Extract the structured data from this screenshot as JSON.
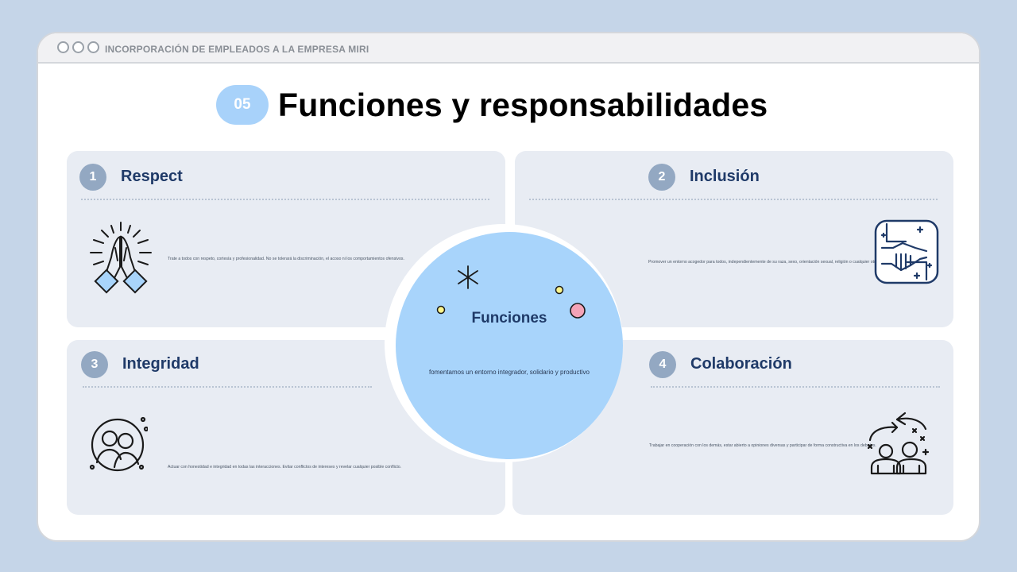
{
  "window": {
    "title": "INCORPORACIÓN DE EMPLEADOS A LA EMPRESA MIRI"
  },
  "header": {
    "number": "05",
    "title": "Funciones y responsabilidades"
  },
  "center": {
    "title": "Funciones",
    "description": "fomentamos un entorno integrador, solidario y productivo"
  },
  "cards": [
    {
      "number": "1",
      "title": "Respect",
      "description": "Trate a todos con respeto, cortesía y profesionalidad. No se tolerará la discriminación, el acoso ni los comportamientos ofensivos.",
      "icon": "praying-hands-icon"
    },
    {
      "number": "2",
      "title": "Inclusión",
      "description": "Promover un entorno acogedor para todos, independientemente de su raza, sexo, orientación sexual, religión o cualquier otra característica protegida.",
      "icon": "handshake-icon"
    },
    {
      "number": "3",
      "title": "Integridad",
      "description": "Actuar con honestidad e integridad en todas las interacciones. Evitar conflictos de intereses y revelar cualquier posible conflicto.",
      "icon": "people-circle-icon"
    },
    {
      "number": "4",
      "title": "Colaboración",
      "description": "Trabajar en cooperación con los demás, estar abierto a opiniones diversas y participar de forma constructiva en los debates.",
      "icon": "team-arrows-icon"
    }
  ],
  "colors": {
    "background": "#c5d5e8",
    "card": "#e8ecf3",
    "accent_blue": "#a8d4fb",
    "badge": "#93a8c2",
    "heading_navy": "#1f3a68",
    "sparkle_yellow": "#fbf58c",
    "sparkle_pink": "#f4a3b7"
  }
}
